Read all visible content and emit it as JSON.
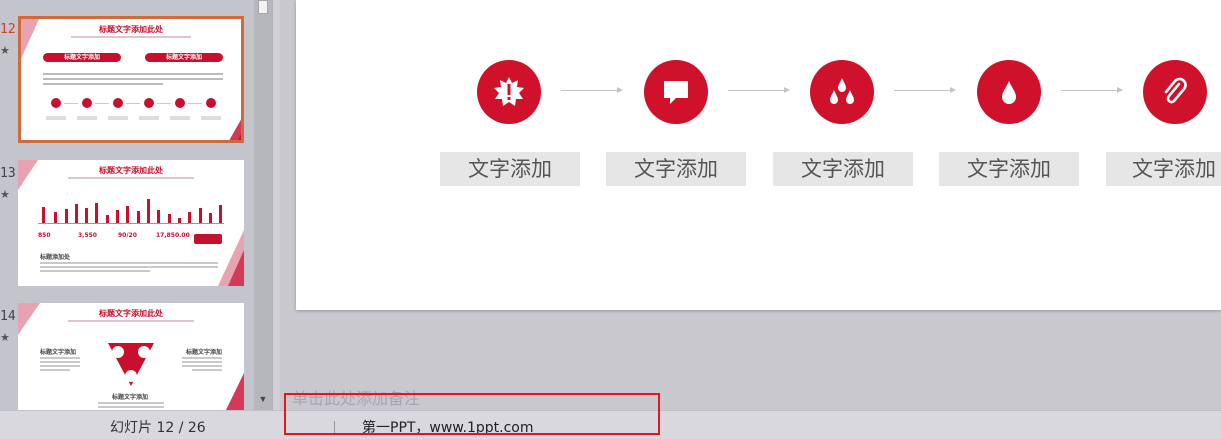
{
  "thumbnails": [
    {
      "number": "12",
      "star": "★",
      "title": "标题文字添加此处",
      "pills": [
        "标题文字添加",
        "标题文字添加"
      ]
    },
    {
      "number": "13",
      "star": "★",
      "title": "标题文字添加此处",
      "stats": [
        "850",
        "3,550",
        "90/20",
        "17,850.00"
      ],
      "subheading": "标题添加处"
    },
    {
      "number": "14",
      "star": "★",
      "title": "标题文字添加此处",
      "left_heading": "标题文字添加",
      "right_heading": "标题文字添加",
      "bottom_heading": "标题文字添加"
    }
  ],
  "slide": {
    "steps": [
      {
        "icon": "starburst-alert-icon",
        "label": "文字添加"
      },
      {
        "icon": "speech-bubble-icon",
        "label": "文字添加"
      },
      {
        "icon": "three-drops-icon",
        "label": "文字添加"
      },
      {
        "icon": "single-drop-icon",
        "label": "文字添加"
      },
      {
        "icon": "paperclip-icon",
        "label": "文字添加"
      }
    ]
  },
  "notes": {
    "placeholder": "单击此处添加备注"
  },
  "status": {
    "slide_counter": "幻灯片 12 / 26",
    "theme_name": "第一PPT，www.1ppt.com"
  },
  "colors": {
    "accent": "#d0112b",
    "selection_border": "#d06a3a",
    "highlight_box": "#e8141c"
  }
}
